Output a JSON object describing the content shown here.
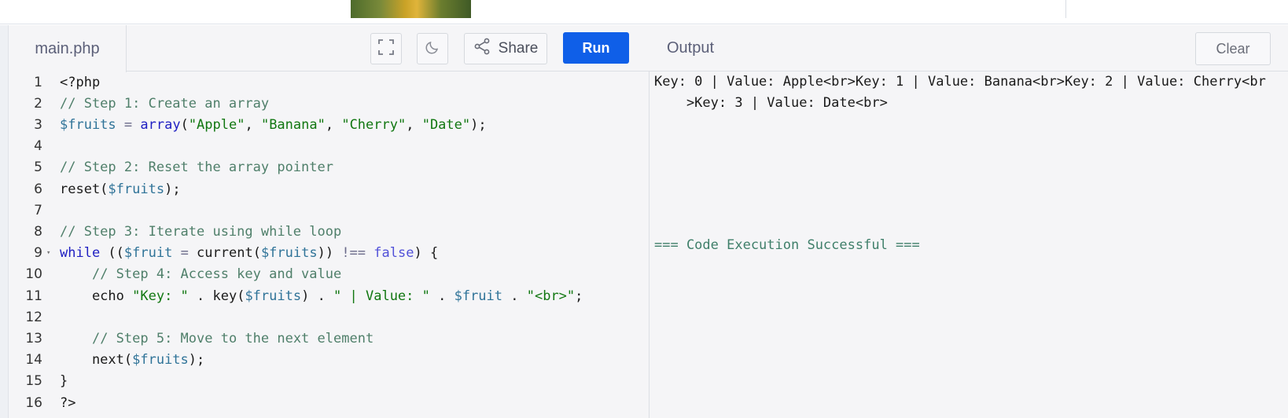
{
  "editor": {
    "file_name": "main.php",
    "share_label": "Share",
    "run_label": "Run",
    "icons": {
      "fullscreen": "fullscreen-icon",
      "theme": "moon-icon",
      "share": "share-icon"
    },
    "lines": [
      {
        "n": "1",
        "tokens": [
          [
            "src",
            "<?php"
          ]
        ]
      },
      {
        "n": "2",
        "tokens": [
          [
            "c-comment",
            "// Step 1: Create an array"
          ]
        ]
      },
      {
        "n": "3",
        "tokens": [
          [
            "c-var",
            "$fruits"
          ],
          [
            "c-op",
            " = "
          ],
          [
            "c-keyword",
            "array"
          ],
          [
            "src",
            "("
          ],
          [
            "c-string",
            "\"Apple\""
          ],
          [
            "src",
            ", "
          ],
          [
            "c-string",
            "\"Banana\""
          ],
          [
            "src",
            ", "
          ],
          [
            "c-string",
            "\"Cherry\""
          ],
          [
            "src",
            ", "
          ],
          [
            "c-string",
            "\"Date\""
          ],
          [
            "src",
            ");"
          ]
        ]
      },
      {
        "n": "4",
        "tokens": []
      },
      {
        "n": "5",
        "tokens": [
          [
            "c-comment",
            "// Step 2: Reset the array pointer"
          ]
        ]
      },
      {
        "n": "6",
        "tokens": [
          [
            "src",
            "reset("
          ],
          [
            "c-var",
            "$fruits"
          ],
          [
            "src",
            ");"
          ]
        ]
      },
      {
        "n": "7",
        "tokens": []
      },
      {
        "n": "8",
        "tokens": [
          [
            "c-comment",
            "// Step 3: Iterate using while loop"
          ]
        ]
      },
      {
        "n": "9",
        "fold": true,
        "tokens": [
          [
            "c-keyword",
            "while"
          ],
          [
            "src",
            " (("
          ],
          [
            "c-var",
            "$fruit"
          ],
          [
            "c-op",
            " = "
          ],
          [
            "src",
            "current("
          ],
          [
            "c-var",
            "$fruits"
          ],
          [
            "src",
            ")) "
          ],
          [
            "c-op",
            "!=="
          ],
          [
            "src",
            " "
          ],
          [
            "c-bool",
            "false"
          ],
          [
            "src",
            ") {"
          ]
        ]
      },
      {
        "n": "10",
        "tokens": [
          [
            "src",
            "    "
          ],
          [
            "c-comment",
            "// Step 4: Access key and value"
          ]
        ]
      },
      {
        "n": "11",
        "tokens": [
          [
            "src",
            "    echo "
          ],
          [
            "c-string",
            "\"Key: \""
          ],
          [
            "src",
            " . key("
          ],
          [
            "c-var",
            "$fruits"
          ],
          [
            "src",
            ") . "
          ],
          [
            "c-string",
            "\" | Value: \""
          ],
          [
            "src",
            " . "
          ],
          [
            "c-var",
            "$fruit"
          ],
          [
            "src",
            " . "
          ],
          [
            "c-string",
            "\"<br>\""
          ],
          [
            "src",
            ";"
          ]
        ]
      },
      {
        "n": "12",
        "tokens": []
      },
      {
        "n": "13",
        "tokens": [
          [
            "src",
            "    "
          ],
          [
            "c-comment",
            "// Step 5: Move to the next element"
          ]
        ]
      },
      {
        "n": "14",
        "tokens": [
          [
            "src",
            "    next("
          ],
          [
            "c-var",
            "$fruits"
          ],
          [
            "src",
            ");"
          ]
        ]
      },
      {
        "n": "15",
        "tokens": [
          [
            "src",
            "}"
          ]
        ]
      },
      {
        "n": "16",
        "tokens": [
          [
            "src",
            "?>"
          ]
        ]
      }
    ]
  },
  "output": {
    "title": "Output",
    "clear_label": "Clear",
    "lines": [
      "Key: 0 | Value: Apple<br>Key: 1 | Value: Banana<br>Key: 2 | Value: Cherry<br",
      "    >Key: 3 | Value: Date<br>"
    ],
    "success": "=== Code Execution Successful ==="
  }
}
